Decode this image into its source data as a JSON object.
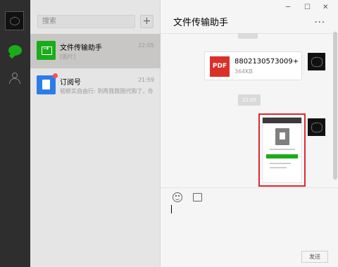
{
  "sidebar": {
    "avatar_icon": "user-avatar-icon",
    "chat_icon": "chat-bubble-icon",
    "contacts_icon": "contacts-icon"
  },
  "conversation_list": {
    "search_placeholder": "搜索",
    "add_label": "+",
    "items": [
      {
        "title": "文件传输助手",
        "time": "22:05",
        "preview": "[图片]",
        "icon": "file-transfer-icon",
        "icon_color": "#1aad19"
      },
      {
        "title": "订阅号",
        "time": "21:59",
        "preview": "韧根实自由行: 到再我我国代购了，你们着...",
        "icon": "subscription-icon",
        "icon_color": "#2b7ce9"
      }
    ]
  },
  "chat": {
    "title": "文件传输助手",
    "more_label": "...",
    "window_controls": {
      "minimize": "─",
      "maximize": "☐",
      "close": "✕"
    },
    "messages": [
      {
        "type": "file",
        "file_icon_label": "PDF",
        "file_name": "8802130573009+8...",
        "file_size": "364KB"
      },
      {
        "type": "time",
        "text": "22:05"
      },
      {
        "type": "image"
      }
    ],
    "input": {
      "emoji_icon": "emoji-icon",
      "folder_icon": "folder-icon"
    },
    "send_label": "发送"
  },
  "colors": {
    "accent": "#1aad19",
    "highlight": "#e0262d",
    "pdf": "#d9302a"
  }
}
